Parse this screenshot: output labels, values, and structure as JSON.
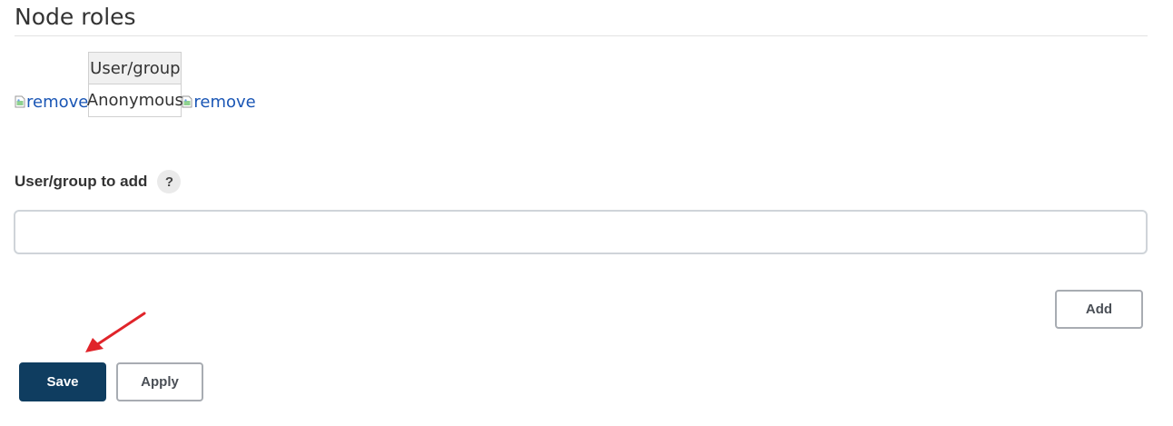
{
  "section": {
    "title": "Node roles"
  },
  "role_table": {
    "column_header": "User/group",
    "rows": [
      {
        "name": "Anonymous"
      }
    ],
    "remove_alt_text": "remove"
  },
  "add_field": {
    "label": "User/group to add",
    "help_icon": "?",
    "value": "",
    "placeholder": ""
  },
  "buttons": {
    "add_label": "Add",
    "save_label": "Save",
    "apply_label": "Apply"
  },
  "annotation": {
    "arrow_color": "#e0242a",
    "arrow_target": "save-button"
  },
  "colors": {
    "primary_button": "#0f3d60",
    "link": "#1a56b5"
  }
}
